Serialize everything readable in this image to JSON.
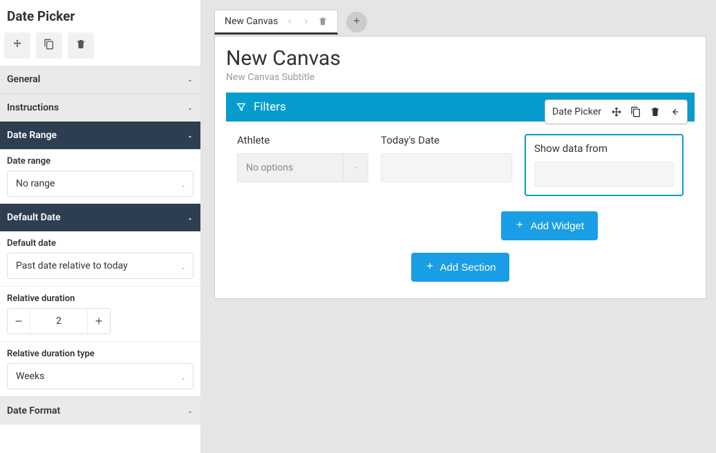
{
  "sidebar": {
    "title": "Date Picker",
    "sections": {
      "general": {
        "label": "General"
      },
      "instructions": {
        "label": "Instructions"
      },
      "dateRange": {
        "label": "Date Range"
      },
      "defaultDate": {
        "label": "Default Date"
      },
      "dateFormat": {
        "label": "Date Format"
      }
    },
    "dateRange": {
      "fieldLabel": "Date range",
      "value": "No range"
    },
    "defaultDate": {
      "fieldLabel": "Default date",
      "value": "Past date relative to today",
      "relativeDurationLabel": "Relative duration",
      "relativeDurationValue": "2",
      "relativeDurationTypeLabel": "Relative duration type",
      "relativeDurationTypeValue": "Weeks"
    }
  },
  "tabs": {
    "active": "New Canvas"
  },
  "canvas": {
    "title": "New Canvas",
    "subtitle": "New Canvas Subtitle"
  },
  "filters": {
    "header": "Filters",
    "popup": {
      "label": "Date Picker"
    },
    "athleteLabel": "Athlete",
    "athletePlaceholder": "No options",
    "todaysDateLabel": "Today's Date",
    "showDataLabel": "Show data from"
  },
  "buttons": {
    "addWidget": "Add Widget",
    "addSection": "Add Section"
  }
}
